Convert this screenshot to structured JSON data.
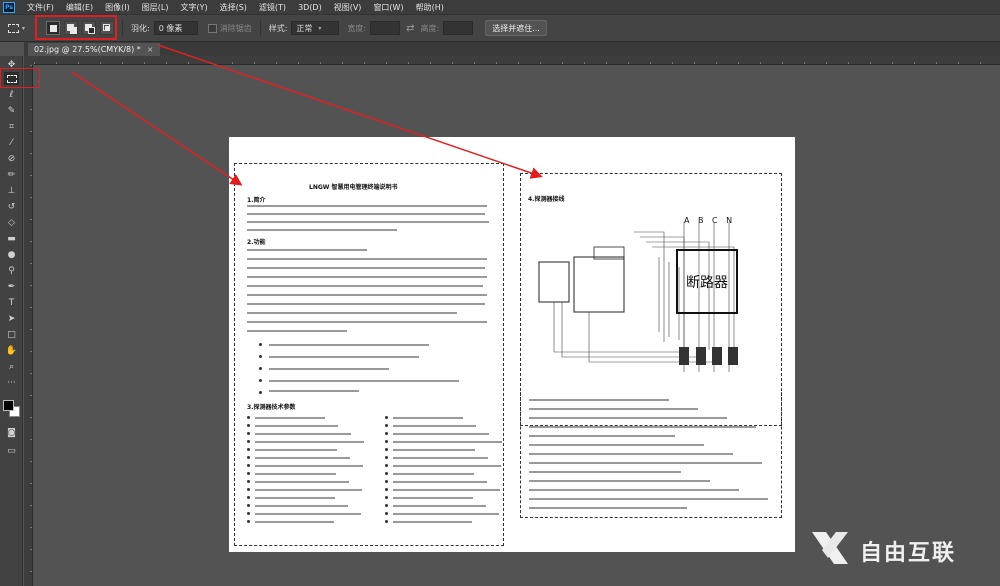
{
  "app": {
    "logo": "Ps"
  },
  "menu": [
    "文件(F)",
    "编辑(E)",
    "图像(I)",
    "图层(L)",
    "文字(Y)",
    "选择(S)",
    "滤镜(T)",
    "3D(D)",
    "视图(V)",
    "窗口(W)",
    "帮助(H)"
  ],
  "options": {
    "feather_label": "羽化:",
    "feather_value": "0 像素",
    "antialias_label": "消除锯齿",
    "style_label": "样式:",
    "style_value": "正常",
    "width_label": "宽度:",
    "height_label": "高度:",
    "select_mask_button": "选择并遮住..."
  },
  "tab": {
    "title": "02.jpg @ 27.5%(CMYK/8) *",
    "close": "×"
  },
  "tools": [
    "move-tool",
    "rect-marquee-tool",
    "lasso-tool",
    "quick-select-tool",
    "crop-tool",
    "eyedropper-tool",
    "healing-brush-tool",
    "brush-tool",
    "clone-stamp-tool",
    "history-brush-tool",
    "eraser-tool",
    "gradient-tool",
    "blur-tool",
    "dodge-tool",
    "pen-tool",
    "type-tool",
    "path-select-tool",
    "rectangle-tool",
    "hand-tool",
    "zoom-tool"
  ],
  "document": {
    "title": "LNGW 智慧用电管理终端说明书",
    "section1": "1.简介",
    "section2": "2.功能",
    "section3": "3.探测器技术参数",
    "section4": "4.探测器接线",
    "phases": "A B C N",
    "breaker_label": "断路器"
  },
  "watermark": "自由互联"
}
